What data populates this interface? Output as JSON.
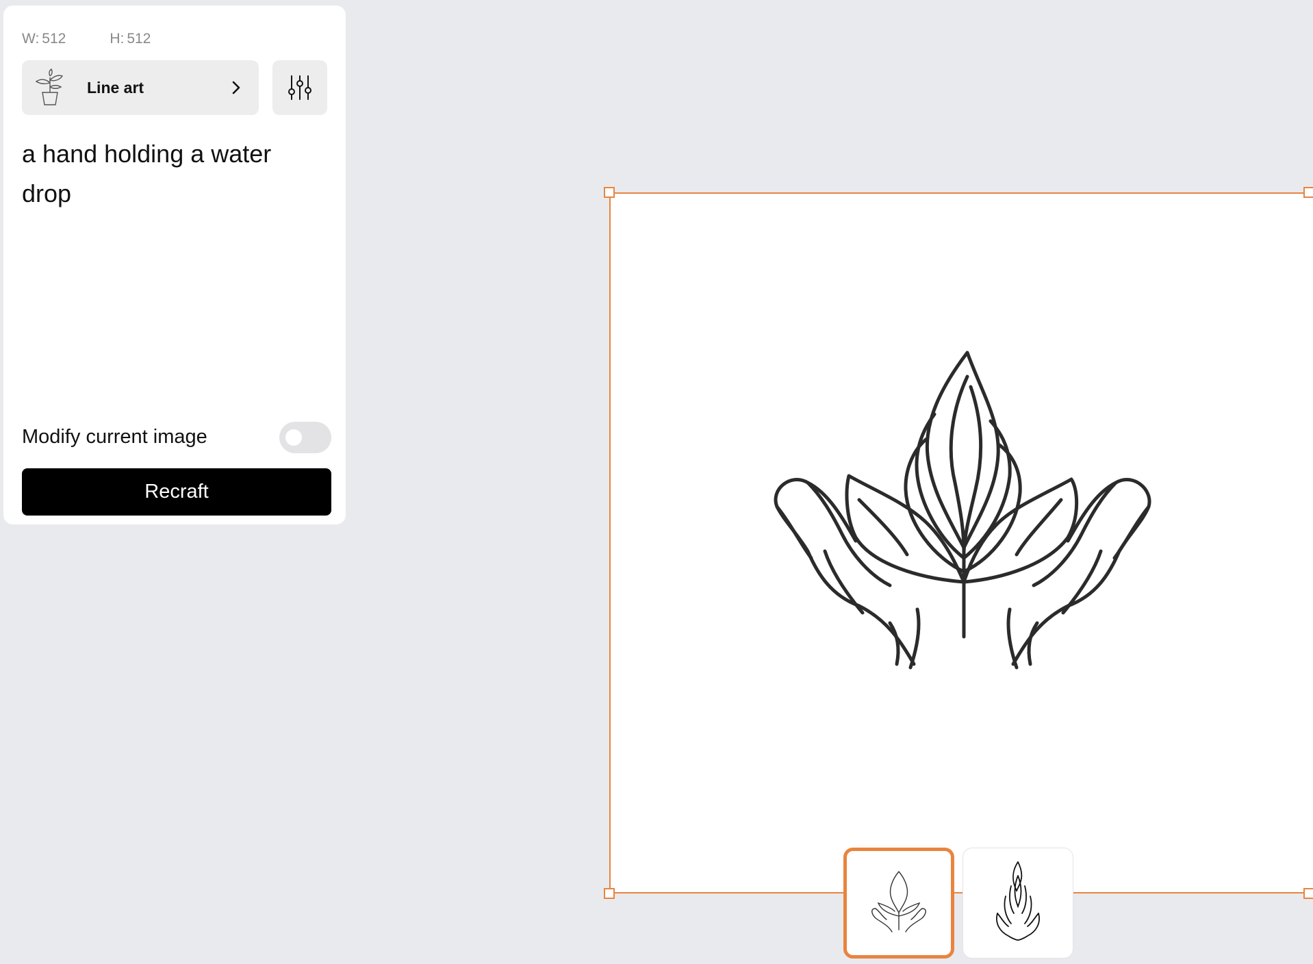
{
  "panel": {
    "width_label": "W:",
    "width_value": "512",
    "height_label": "H:",
    "height_value": "512",
    "style": {
      "label": "Line art",
      "thumbnail_icon": "potted-plant-icon",
      "chevron_icon": "chevron-right-icon"
    },
    "settings_icon": "sliders-icon",
    "prompt_text": "a hand holding a water drop",
    "modify_label": "Modify current image",
    "modify_enabled": false,
    "recraft_label": "Recraft"
  },
  "canvas": {
    "selection_color": "#e8843f",
    "main_image_icon": "hands-holding-leaves-illustration",
    "variants": [
      {
        "icon": "hands-holding-leaves-thumbnail",
        "selected": true
      },
      {
        "icon": "hands-with-flame-thumbnail",
        "selected": false
      }
    ]
  }
}
